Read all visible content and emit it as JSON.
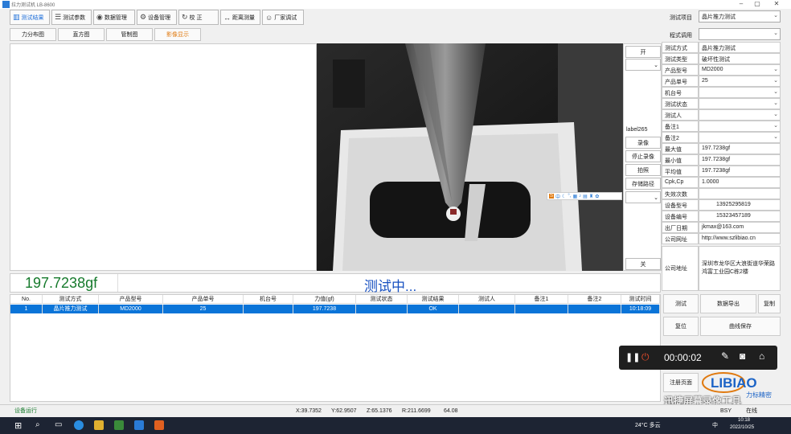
{
  "app": {
    "title": "拉力测试机 LB-8600"
  },
  "toolbar": {
    "items": [
      {
        "label": "测试结果"
      },
      {
        "label": "测试参数"
      },
      {
        "label": "数据管理"
      },
      {
        "label": "设备管理"
      },
      {
        "label": "校  正"
      },
      {
        "label": "距离测量"
      },
      {
        "label": "厂家调试"
      }
    ],
    "test_item_label": "测试项目",
    "test_item_value": "晶片推力测试",
    "program_label": "程式调用",
    "program_value": ""
  },
  "subtabs": [
    {
      "label": "力分布图"
    },
    {
      "label": "直方图"
    },
    {
      "label": "管制图"
    },
    {
      "label": "影像显示"
    }
  ],
  "camera_controls": {
    "open": "开",
    "label": "label265",
    "record": "录像",
    "stop_record": "停止录像",
    "photo": "拍照",
    "save_path": "存储路径",
    "close": "关"
  },
  "ime_bar": {
    "text": "中"
  },
  "params": [
    {
      "label": "测试方式",
      "value": "晶片推力测试",
      "dropdown": false
    },
    {
      "label": "测试类型",
      "value": "破坏性测试",
      "dropdown": false
    },
    {
      "label": "产品型号",
      "value": "MD2000",
      "dropdown": true
    },
    {
      "label": "产品单号",
      "value": "25",
      "dropdown": true
    },
    {
      "label": "机台号",
      "value": "",
      "dropdown": true
    },
    {
      "label": "测试状态",
      "value": "",
      "dropdown": true
    },
    {
      "label": "测试人",
      "value": "",
      "dropdown": true
    },
    {
      "label": "备注1",
      "value": "",
      "dropdown": true
    },
    {
      "label": "备注2",
      "value": "",
      "dropdown": true
    },
    {
      "label": "最大值",
      "value": "197.7238gf",
      "dropdown": false
    },
    {
      "label": "最小值",
      "value": "197.7238gf",
      "dropdown": false
    },
    {
      "label": "平均值",
      "value": "197.7238gf",
      "dropdown": false
    },
    {
      "label": "Cpk,Cp",
      "value": "1.0000",
      "dropdown": false
    },
    {
      "label": "失效次数",
      "value": "",
      "dropdown": false
    },
    {
      "label": "设备型号",
      "value": "13925295819",
      "dropdown": false
    },
    {
      "label": "设备编号",
      "value": "15323457189",
      "dropdown": false
    },
    {
      "label": "出厂日期",
      "value": "jkmax@163.com",
      "dropdown": false
    },
    {
      "label": "公司网址",
      "value": "http://www.szlibiao.cn",
      "dropdown": false
    }
  ],
  "address": {
    "label": "公司地址",
    "value": "深圳市龙华区大浪街道华荣路鸿富工业园C栋2楼"
  },
  "readout": {
    "value": "197.7238gf",
    "status": "测试中..."
  },
  "table": {
    "headers": [
      "No.",
      "测试方式",
      "产品型号",
      "产品单号",
      "机台号",
      "力值(gf)",
      "测试状态",
      "测试结果",
      "测试人",
      "备注1",
      "备注2",
      "测试时间"
    ],
    "rows": [
      [
        "1",
        "晶片推力测试",
        "MD2000",
        "25",
        "",
        "197.7238",
        "",
        "OK",
        "",
        "",
        "",
        "10:18:09"
      ]
    ]
  },
  "actions": {
    "test": "测试",
    "export": "数据导出",
    "copy": "复制",
    "reset": "复位",
    "curve_save": "曲线保存",
    "register": "注册页面"
  },
  "recorder": {
    "time": "00:00:02"
  },
  "logo": {
    "text": "LIBIAO",
    "sub": "力标精密"
  },
  "watermark": {
    "text": "迅捷屏幕录像工具"
  },
  "statusbar": {
    "left": "设备运行",
    "x": "X:39.7352",
    "y": "Y:62.9507",
    "z": "Z:65.1376",
    "r": "R:211.6699",
    "extra": "64.08",
    "bsy": "BSY",
    "online": "在线"
  },
  "taskbar": {
    "weather": "24°C 多云",
    "ime": "中",
    "time": "10:18",
    "date": "2022/10/25"
  }
}
